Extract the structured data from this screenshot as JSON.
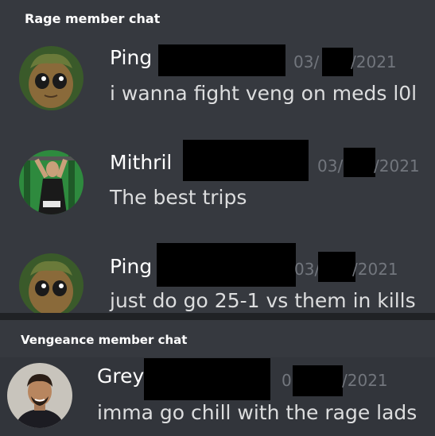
{
  "sections": {
    "rage": {
      "title": "Rage member chat",
      "messages": [
        {
          "author": "Ping",
          "date_prefix": "03/",
          "date_suffix": "/2021",
          "text": "i wanna fight veng on meds l0l"
        },
        {
          "author": "Mithril",
          "date_prefix": "03/",
          "date_suffix": "/2021",
          "text": "The best trips"
        },
        {
          "author": "Ping",
          "date_prefix": "03/",
          "date_suffix": "/2021",
          "text": "just do go 25-1 vs them in kills"
        }
      ]
    },
    "vengeance": {
      "title": "Vengeance member chat",
      "messages": [
        {
          "author": "Grey",
          "date_prefix": "0",
          "date_suffix": "/2021",
          "text": "imma go chill with the rage lads"
        }
      ]
    }
  },
  "colors": {
    "background": "#36393f",
    "divider": "#202225",
    "username": "#ffffff",
    "message_text": "#dcddde",
    "timestamp": "#72767d",
    "redaction": "#000000"
  },
  "avatars": [
    "baby-groot-avatar",
    "gym-user-avatar",
    "baby-groot-avatar",
    "man-portrait-avatar"
  ]
}
